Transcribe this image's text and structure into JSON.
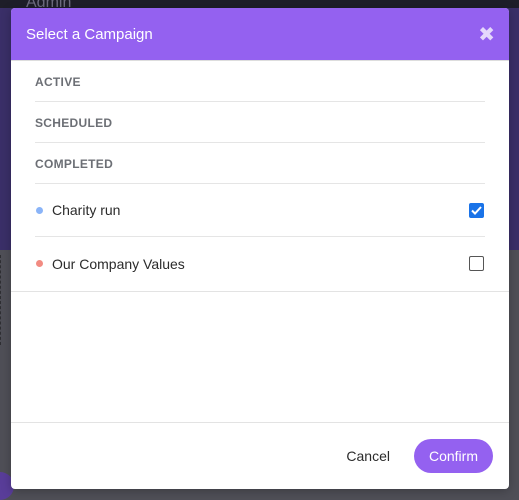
{
  "background": {
    "title": "Admin"
  },
  "modal": {
    "title": "Select a Campaign",
    "close_icon": "close-icon",
    "sections": [
      {
        "label": "ACTIVE"
      },
      {
        "label": "SCHEDULED"
      },
      {
        "label": "COMPLETED"
      }
    ],
    "campaigns": [
      {
        "name": "Charity run",
        "dot_color": "#8ab4f8",
        "checked": true
      },
      {
        "name": "Our Company Values",
        "dot_color": "#f28b82",
        "checked": false
      }
    ],
    "footer": {
      "cancel_label": "Cancel",
      "confirm_label": "Confirm"
    }
  },
  "colors": {
    "accent": "#9461f0",
    "checkbox_checked": "#1a73e8"
  }
}
